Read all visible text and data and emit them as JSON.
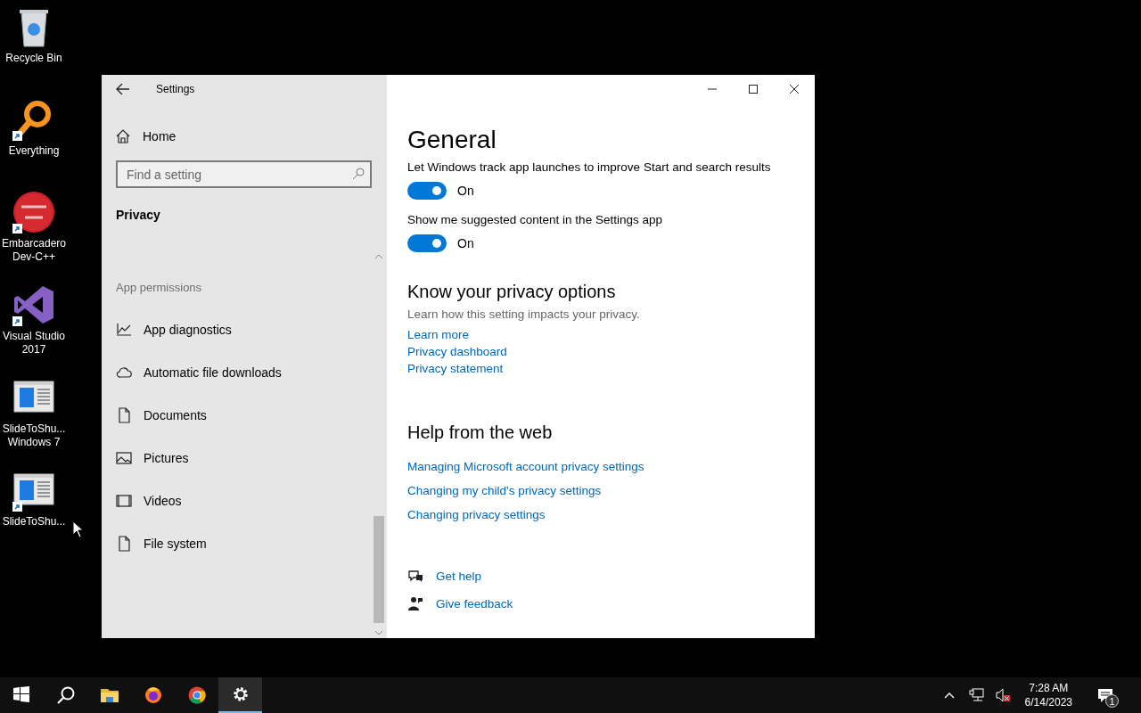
{
  "desktop_icons": [
    {
      "label": "Recycle Bin",
      "kind": "recycle",
      "shortcut": false
    },
    {
      "label": "Everything",
      "kind": "magnifier",
      "shortcut": true
    },
    {
      "label": "Embarcadero Dev-C++",
      "kind": "devcpp",
      "shortcut": true
    },
    {
      "label": "Visual Studio 2017",
      "kind": "vs",
      "shortcut": true
    },
    {
      "label": "SlideToShu... Windows 7",
      "kind": "window",
      "shortcut": false
    },
    {
      "label": "SlideToShu...",
      "kind": "window",
      "shortcut": true
    }
  ],
  "window": {
    "title": "Settings",
    "sidebar": {
      "home": "Home",
      "search": {
        "placeholder": "Find a setting"
      },
      "section": "Privacy",
      "group": "App permissions",
      "items": [
        {
          "label": "App diagnostics",
          "kind": "chart"
        },
        {
          "label": "Automatic file downloads",
          "kind": "cloud"
        },
        {
          "label": "Documents",
          "kind": "document"
        },
        {
          "label": "Pictures",
          "kind": "picture"
        },
        {
          "label": "Videos",
          "kind": "video"
        },
        {
          "label": "File system",
          "kind": "document"
        }
      ]
    },
    "content": {
      "heading": "General",
      "toggles": [
        {
          "label": "Let Windows track app launches to improve Start and search results",
          "on": true,
          "state_text": "On"
        },
        {
          "label": "Show me suggested content in the Settings app",
          "on": true,
          "state_text": "On"
        }
      ],
      "privacy_options": {
        "title": "Know your privacy options",
        "description": "Learn how this setting impacts your privacy.",
        "links": [
          "Learn more",
          "Privacy dashboard",
          "Privacy statement"
        ]
      },
      "help": {
        "title": "Help from the web",
        "links": [
          "Managing Microsoft account privacy settings",
          "Changing my child's privacy settings",
          "Changing privacy settings"
        ]
      },
      "footer_links": [
        {
          "label": "Get help",
          "kind": "help"
        },
        {
          "label": "Give feedback",
          "kind": "feedback"
        }
      ]
    }
  },
  "taskbar": {
    "apps": [
      {
        "kind": "start",
        "selected": false
      },
      {
        "kind": "search",
        "selected": false
      },
      {
        "kind": "explorer",
        "selected": false
      },
      {
        "kind": "firefox",
        "selected": false
      },
      {
        "kind": "chrome",
        "selected": false
      },
      {
        "kind": "settings",
        "selected": true
      }
    ],
    "time": "7:28 AM",
    "date": "6/14/2023",
    "notification_count": "1"
  }
}
